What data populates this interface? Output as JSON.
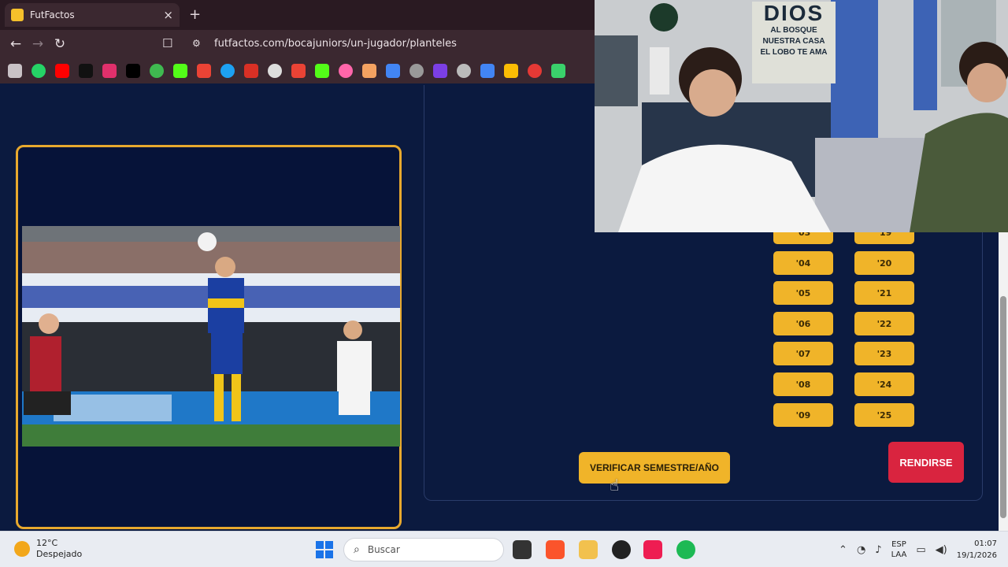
{
  "browser": {
    "tab_title": "FutFactos",
    "url": "futfactos.com/bocajuniors/un-jugador/planteles",
    "new_tab": "+",
    "close": "×"
  },
  "game": {
    "years_col1": [
      "'03",
      "'04",
      "'05",
      "'06",
      "'07",
      "'08",
      "'09"
    ],
    "years_col2": [
      "'19",
      "'20",
      "'21",
      "'22",
      "'23",
      "'24",
      "'25"
    ],
    "verify_label": "VERIFICAR SEMESTRE/AÑO",
    "give_up_label": "RENDIRSE"
  },
  "webcam": {
    "poster_big": "DIOS",
    "poster_line1": "AL BOSQUE",
    "poster_line2": "NUESTRA CASA",
    "poster_line3": "EL LOBO TE AMA"
  },
  "taskbar": {
    "weather_temp": "12°C",
    "weather_desc": "Despejado",
    "search_placeholder": "Buscar",
    "lang_top": "ESP",
    "lang_bottom": "LAA",
    "time": "01:07",
    "date": "19/1/2026"
  },
  "colors": {
    "page_bg": "#0b1a3f",
    "accent_gold": "#f0b429",
    "danger_red": "#d9243f"
  }
}
